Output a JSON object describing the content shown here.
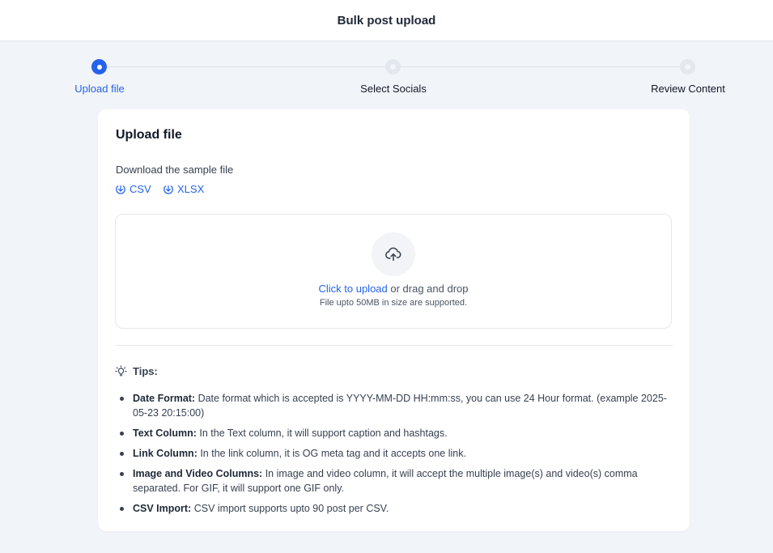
{
  "header": {
    "title": "Bulk post upload"
  },
  "stepper": {
    "steps": [
      {
        "label": "Upload file",
        "state": "active"
      },
      {
        "label": "Select Socials",
        "state": "upcoming"
      },
      {
        "label": "Review Content",
        "state": "upcoming"
      }
    ]
  },
  "card": {
    "title": "Upload file",
    "sample_label": "Download the sample file",
    "downloads": [
      {
        "label": "CSV",
        "icon": "download-circle-icon"
      },
      {
        "label": "XLSX",
        "icon": "download-circle-icon"
      }
    ],
    "dropzone": {
      "icon": "cloud-upload-icon",
      "link_text": "Click to upload",
      "rest_text": " or drag and drop",
      "hint": "File upto 50MB in size are supported."
    },
    "tips": {
      "heading": "Tips:",
      "icon": "lightbulb-icon",
      "items": [
        {
          "title": "Date Format:",
          "text": " Date format which is accepted is YYYY-MM-DD HH:mm:ss, you can use 24 Hour format. (example 2025-05-23 20:15:00)"
        },
        {
          "title": "Text Column:",
          "text": " In the Text column, it will support caption and hashtags."
        },
        {
          "title": "Link Column:",
          "text": " In the link column, it is OG meta tag and it accepts one link."
        },
        {
          "title": "Image and Video Columns:",
          "text": " In image and video column, it will accept the multiple image(s) and video(s) comma separated. For GIF, it will support one GIF only."
        },
        {
          "title": "CSV Import:",
          "text": " CSV import supports upto 90 post per CSV."
        }
      ]
    }
  },
  "colors": {
    "accent": "#2563eb",
    "background": "#f1f4f8",
    "card": "#ffffff"
  }
}
